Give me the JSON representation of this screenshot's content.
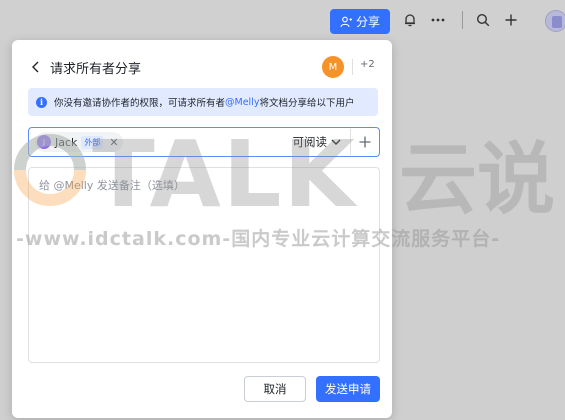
{
  "toolbar": {
    "share_label": "分享",
    "icons": [
      "bell-icon",
      "more-icon",
      "search-icon",
      "plus-icon"
    ]
  },
  "dialog": {
    "title": "请求所有者分享",
    "owner_avatar_initial": "M",
    "more_count": "+2",
    "notice_prefix": "你没有邀请协作者的权限，可请求所有者",
    "notice_mention": "@Melly",
    "notice_suffix": "将文档分享给以下用户",
    "invitee": {
      "name": "Jack",
      "tag": "外部",
      "avatar_initial": "J"
    },
    "permission": "可阅读",
    "note_placeholder": "给 @Melly 发送备注（选填）",
    "cancel_label": "取消",
    "send_label": "发送申请"
  },
  "watermark": {
    "logo": "TALK",
    "logo_cn": "云说",
    "text": "-www.idctalk.com-国内专业云计算交流服务平台-"
  },
  "colors": {
    "primary": "#3370ff",
    "notice_bg": "#e1eaff",
    "owner_avatar": "#f5922a",
    "invitee_avatar": "#8f6af7"
  }
}
